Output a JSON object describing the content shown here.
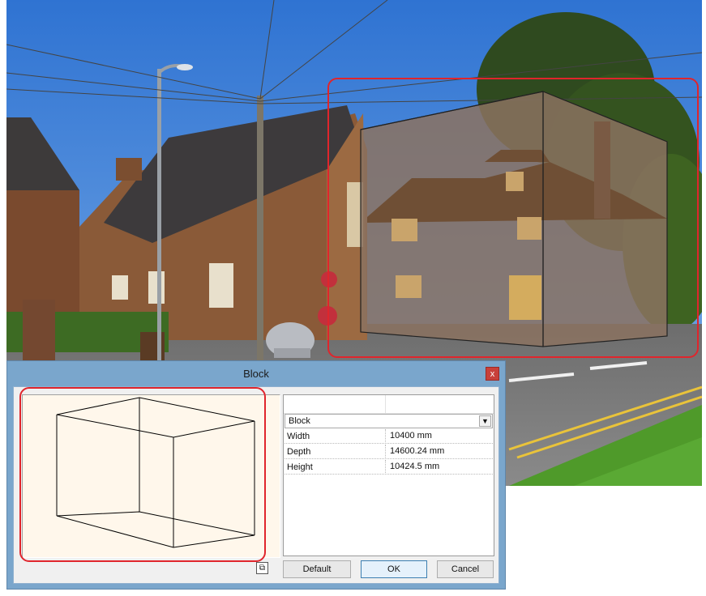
{
  "dialog": {
    "title": "Block",
    "close_label": "x",
    "block_type": "Block",
    "properties": [
      {
        "label": "Width",
        "value": "10400 mm"
      },
      {
        "label": "Depth",
        "value": "14600.24 mm"
      },
      {
        "label": "Height",
        "value": "10424.5 mm"
      }
    ],
    "buttons": {
      "default": "Default",
      "ok": "OK",
      "cancel": "Cancel"
    }
  },
  "colors": {
    "highlight": "#e0252c",
    "preview_bg": "#fff7eb",
    "titlebar": "#7aa6cc"
  },
  "icons": {
    "close": "close-icon",
    "view_toggle": "3d-view-icon",
    "dropdown": "chevron-down-icon"
  }
}
